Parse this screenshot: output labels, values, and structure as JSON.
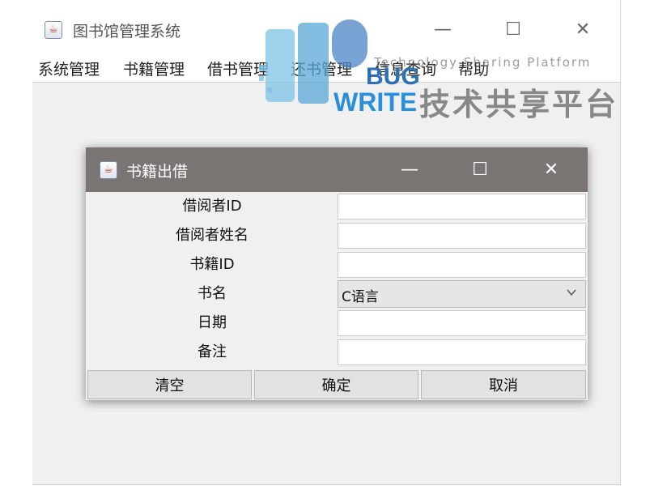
{
  "main_window": {
    "title": "图书馆管理系统",
    "menu": [
      "系统管理",
      "书籍管理",
      "借书管理",
      "还书管理",
      "信息查询",
      "帮助"
    ]
  },
  "dialog": {
    "title": "书籍出借",
    "fields": [
      {
        "label": "借阅者ID",
        "value": ""
      },
      {
        "label": "借阅者姓名",
        "value": ""
      },
      {
        "label": "书籍ID",
        "value": ""
      },
      {
        "label": "书名",
        "selected": "C语言"
      },
      {
        "label": "日期",
        "value": ""
      },
      {
        "label": "备注",
        "value": ""
      }
    ],
    "buttons": {
      "clear": "清空",
      "confirm": "确定",
      "cancel": "取消"
    }
  },
  "watermark": {
    "tagline": "Technology Sharing Platform",
    "brand": "技术共享平台",
    "logo_text": [
      "BUG",
      "WRITE"
    ]
  },
  "icons": {
    "app": "java-cup-icon",
    "minimize": "minimize-icon",
    "maximize": "maximize-icon",
    "close": "close-icon",
    "dropdown": "chevron-down-icon"
  },
  "colors": {
    "dialog_titlebar": "#7a7473",
    "window_background": "#f0f0f0",
    "button_face": "#e2e2e2"
  }
}
